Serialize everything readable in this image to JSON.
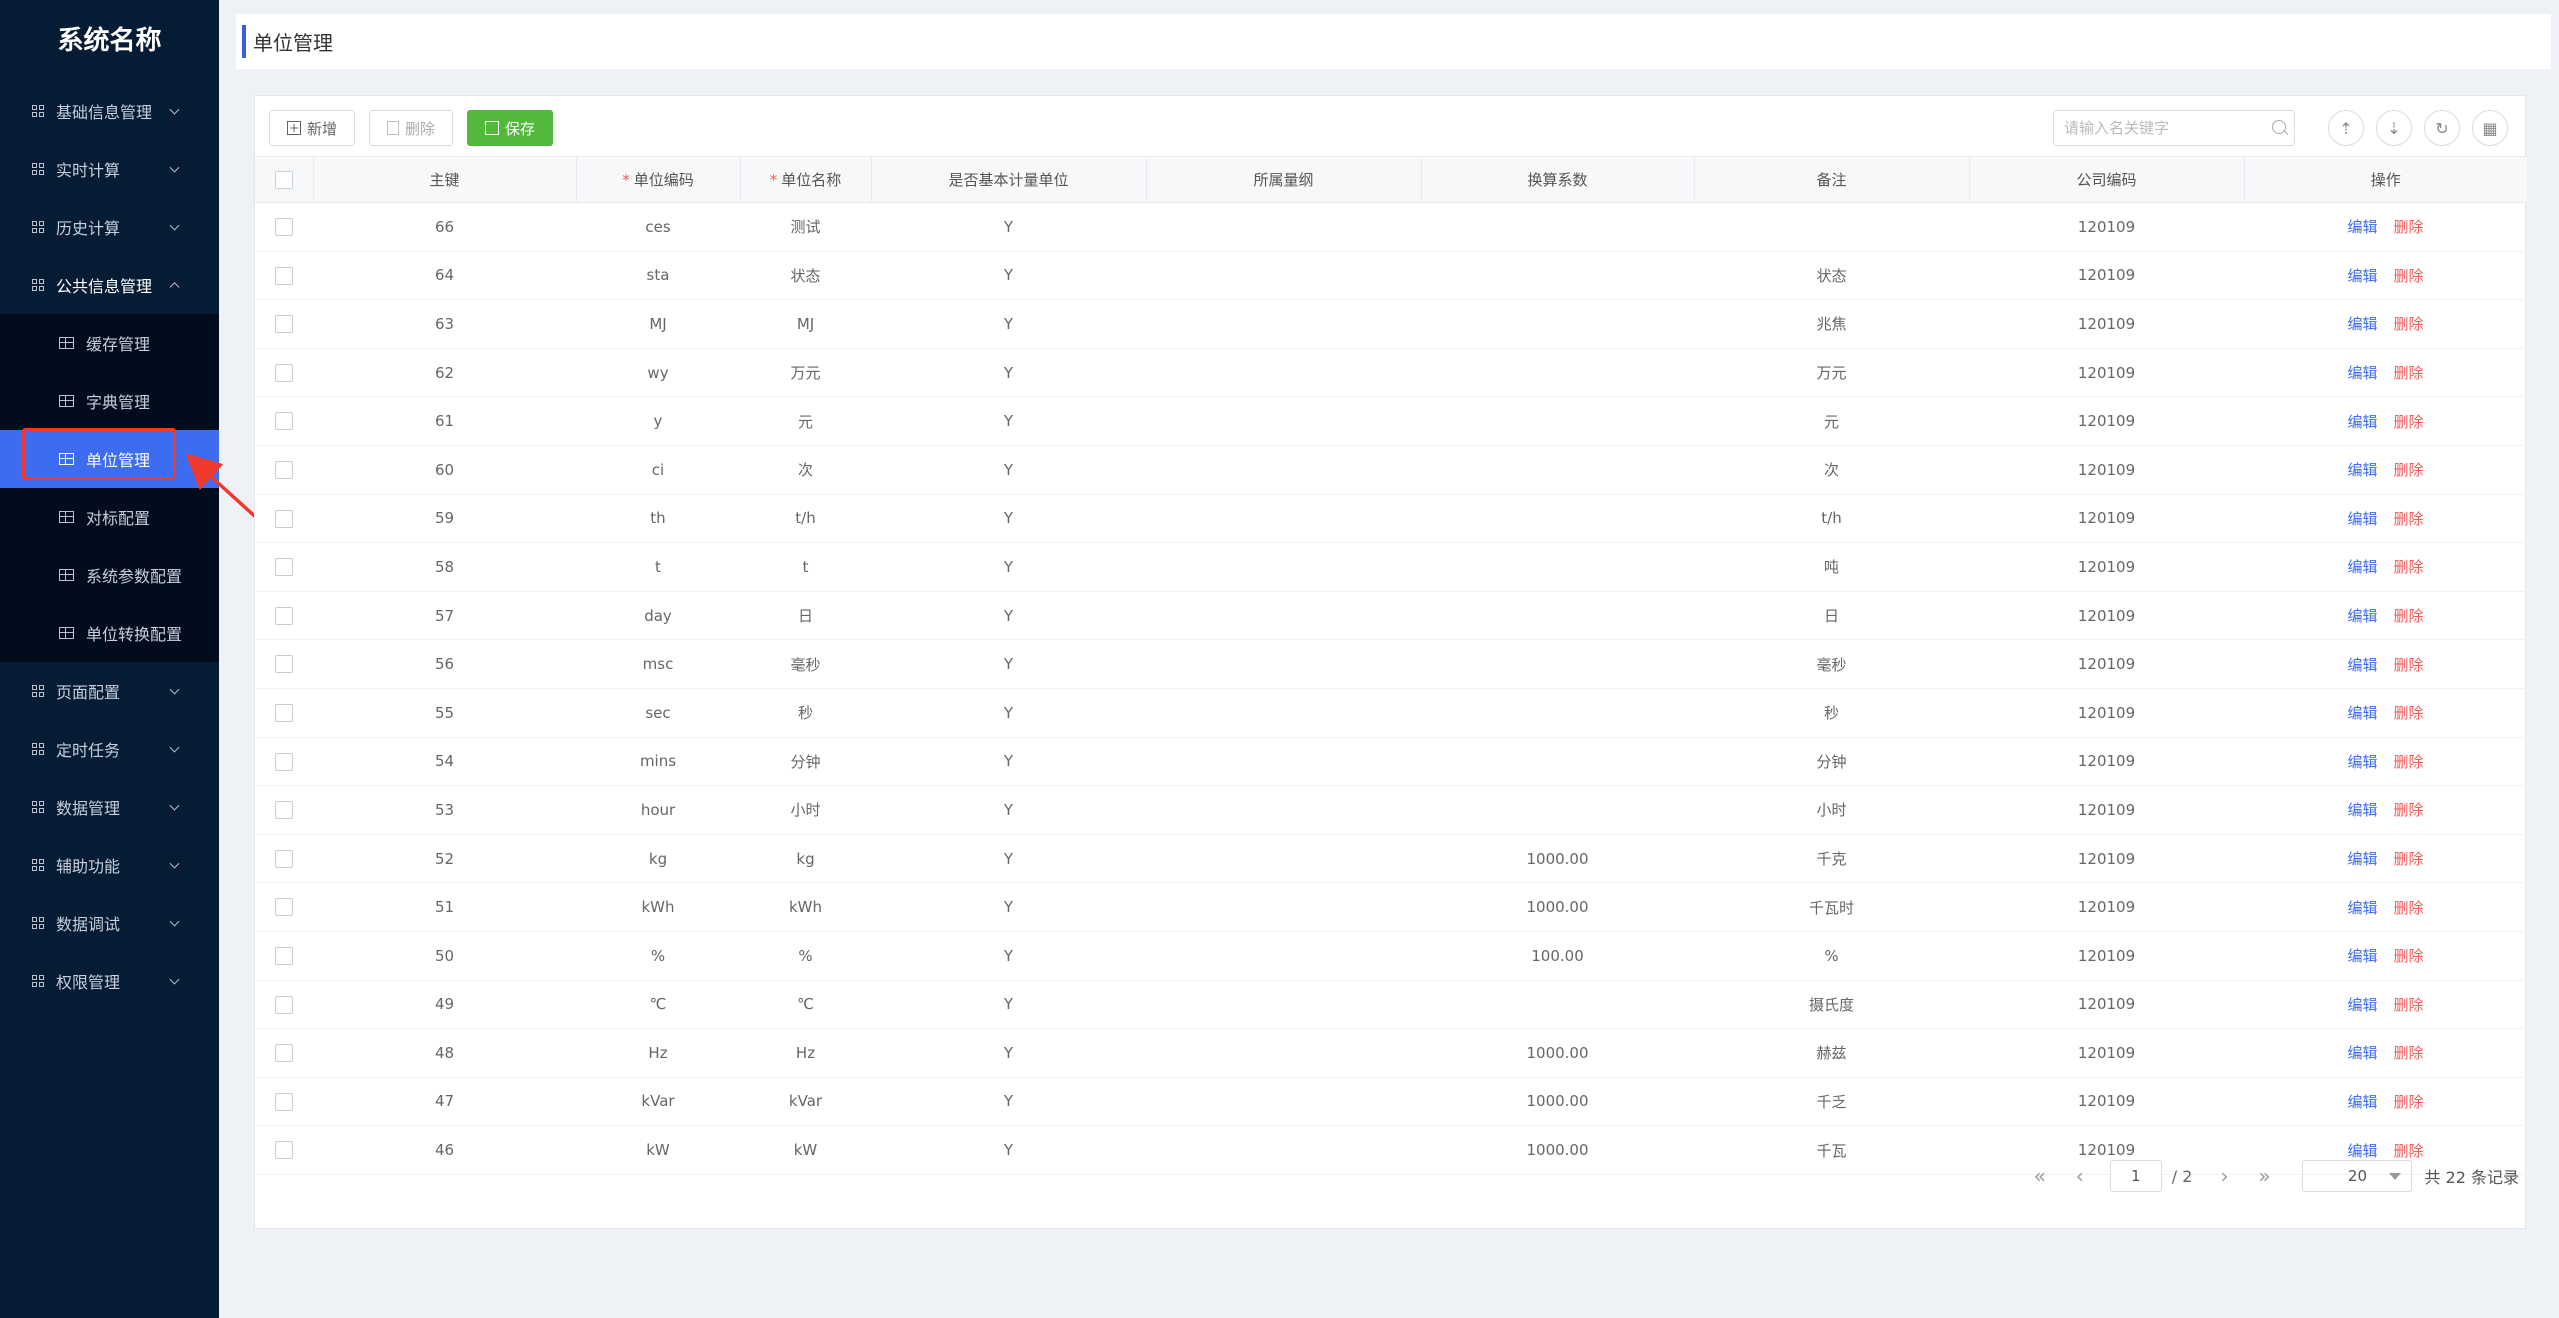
{
  "app": {
    "title": "系统名称"
  },
  "sidebar": {
    "menus": [
      {
        "label": "基础信息管理"
      },
      {
        "label": "实时计算"
      },
      {
        "label": "历史计算"
      },
      {
        "label": "公共信息管理"
      },
      {
        "label": "页面配置"
      },
      {
        "label": "定时任务"
      },
      {
        "label": "数据管理"
      },
      {
        "label": "辅助功能"
      },
      {
        "label": "数据调试"
      },
      {
        "label": "权限管理"
      }
    ],
    "submenu": [
      {
        "label": "缓存管理"
      },
      {
        "label": "字典管理"
      },
      {
        "label": "单位管理"
      },
      {
        "label": "对标配置"
      },
      {
        "label": "系统参数配置"
      },
      {
        "label": "单位转换配置"
      }
    ],
    "active_submenu": "单位管理"
  },
  "page": {
    "title": "单位管理"
  },
  "toolbar": {
    "add_label": "新增",
    "delete_label": "删除",
    "save_label": "保存"
  },
  "search": {
    "placeholder": "请输入名关键字"
  },
  "table": {
    "columns": [
      "主键",
      "单位编码",
      "单位名称",
      "是否基本计量单位",
      "所属量纲",
      "换算系数",
      "备注",
      "公司编码",
      "操作"
    ],
    "required_mark": "*",
    "action_edit": "编辑",
    "action_delete": "删除",
    "rows": [
      [
        "66",
        "ces",
        "测试",
        "Y",
        "",
        "",
        "",
        "120109"
      ],
      [
        "64",
        "sta",
        "状态",
        "Y",
        "",
        "",
        "状态",
        "120109"
      ],
      [
        "63",
        "MJ",
        "MJ",
        "Y",
        "",
        "",
        "兆焦",
        "120109"
      ],
      [
        "62",
        "wy",
        "万元",
        "Y",
        "",
        "",
        "万元",
        "120109"
      ],
      [
        "61",
        "y",
        "元",
        "Y",
        "",
        "",
        "元",
        "120109"
      ],
      [
        "60",
        "ci",
        "次",
        "Y",
        "",
        "",
        "次",
        "120109"
      ],
      [
        "59",
        "th",
        "t/h",
        "Y",
        "",
        "",
        "t/h",
        "120109"
      ],
      [
        "58",
        "t",
        "t",
        "Y",
        "",
        "",
        "吨",
        "120109"
      ],
      [
        "57",
        "day",
        "日",
        "Y",
        "",
        "",
        "日",
        "120109"
      ],
      [
        "56",
        "msc",
        "毫秒",
        "Y",
        "",
        "",
        "毫秒",
        "120109"
      ],
      [
        "55",
        "sec",
        "秒",
        "Y",
        "",
        "",
        "秒",
        "120109"
      ],
      [
        "54",
        "mins",
        "分钟",
        "Y",
        "",
        "",
        "分钟",
        "120109"
      ],
      [
        "53",
        "hour",
        "小时",
        "Y",
        "",
        "",
        "小时",
        "120109"
      ],
      [
        "52",
        "kg",
        "kg",
        "Y",
        "",
        "1000.00",
        "千克",
        "120109"
      ],
      [
        "51",
        "kWh",
        "kWh",
        "Y",
        "",
        "1000.00",
        "千瓦时",
        "120109"
      ],
      [
        "50",
        "%",
        "%",
        "Y",
        "",
        "100.00",
        "%",
        "120109"
      ],
      [
        "49",
        "℃",
        "℃",
        "Y",
        "",
        "",
        "摄氏度",
        "120109"
      ],
      [
        "48",
        "Hz",
        "Hz",
        "Y",
        "",
        "1000.00",
        "赫兹",
        "120109"
      ],
      [
        "47",
        "kVar",
        "kVar",
        "Y",
        "",
        "1000.00",
        "千乏",
        "120109"
      ],
      [
        "46",
        "kW",
        "kW",
        "Y",
        "",
        "1000.00",
        "千瓦",
        "120109"
      ]
    ]
  },
  "pagination": {
    "current": "1",
    "total_pages": "/ 2",
    "page_size": "20",
    "total": "共 22 条记录"
  },
  "colors": {
    "sidebar_bg": "#061b34",
    "active": "#3d6cf0",
    "save": "#52b93d",
    "danger": "#f25c5c",
    "annotation": "#f03a2e"
  },
  "icons": [
    "grid-icon",
    "chevron-down-icon",
    "chevron-up-icon",
    "table-icon",
    "plus-icon",
    "trash-icon",
    "save-icon",
    "search-icon",
    "upload-icon",
    "download-icon",
    "refresh-icon",
    "layout-icon",
    "first-page-icon",
    "prev-page-icon",
    "next-page-icon",
    "last-page-icon"
  ]
}
